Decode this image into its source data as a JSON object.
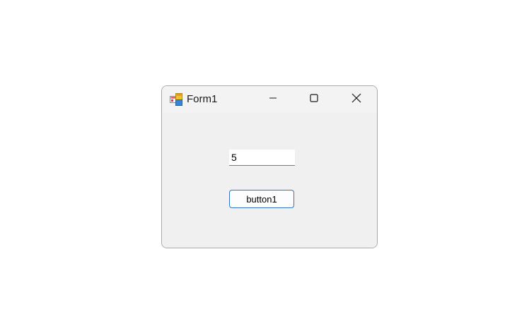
{
  "window": {
    "title": "Form1",
    "icon": "winforms-app-icon"
  },
  "caption_buttons": {
    "minimize": "minimize-icon",
    "maximize": "maximize-icon",
    "close": "close-icon"
  },
  "form": {
    "textbox_value": "5",
    "button_label": "button1"
  },
  "colors": {
    "button_border": "#2f78c6",
    "client_background": "#f0f0f0"
  }
}
